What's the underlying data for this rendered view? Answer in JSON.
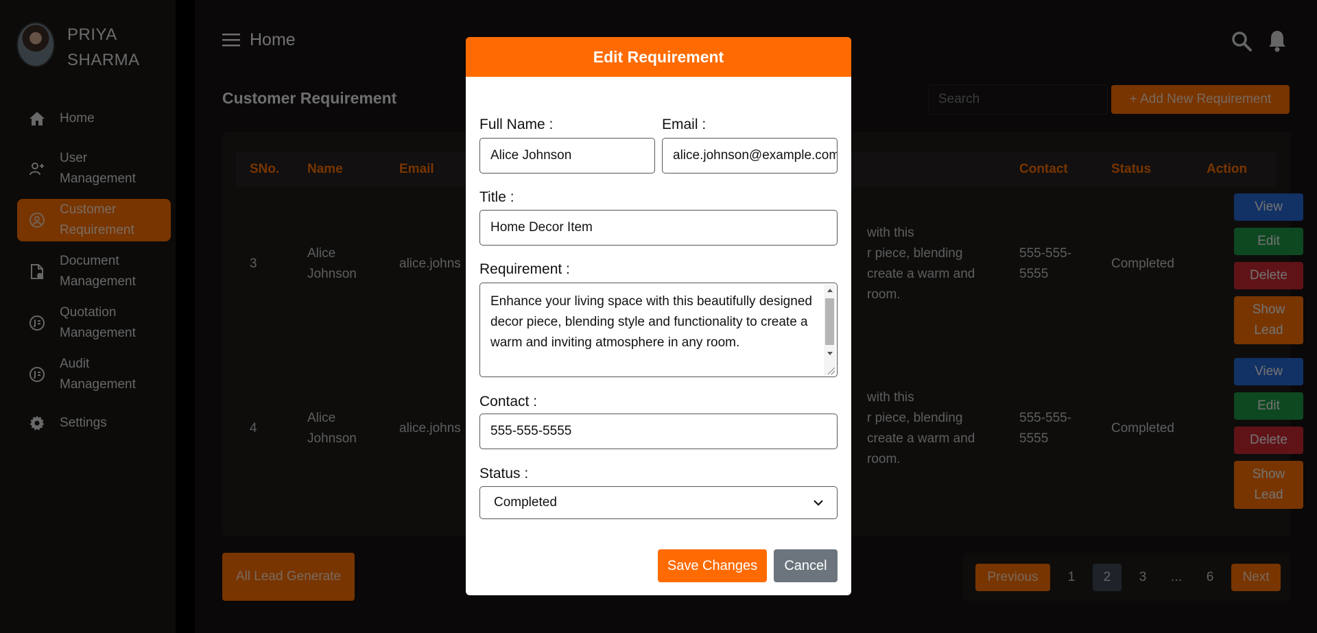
{
  "profile": {
    "name_line1": "PRIYA",
    "name_line2": "SHARMA"
  },
  "sidebar": {
    "items": [
      {
        "label": "Home",
        "icon": "home-icon"
      },
      {
        "label_line1": "User",
        "label_line2": "Management",
        "icon": "user-add-icon"
      },
      {
        "label_line1": "Customer",
        "label_line2": "Requirement",
        "icon": "customer-icon",
        "active": true
      },
      {
        "label_line1": "Document",
        "label_line2": "Management",
        "icon": "document-icon"
      },
      {
        "label_line1": "Quotation",
        "label_line2": "Management",
        "icon": "quotation-icon"
      },
      {
        "label_line1": "Audit",
        "label_line2": "Management",
        "icon": "audit-icon"
      },
      {
        "label": "Settings",
        "icon": "gear-icon"
      }
    ]
  },
  "topbar": {
    "title": "Home"
  },
  "page": {
    "heading": "Customer Requirement",
    "search_placeholder": "Search",
    "add_button": "+ Add New Requirement",
    "all_lead_button": "All Lead Generate"
  },
  "table": {
    "headers": {
      "sno": "SNo.",
      "name": "Name",
      "email": "Email",
      "contact": "Contact",
      "status": "Status",
      "action": "Action"
    },
    "rows": [
      {
        "sno": "3",
        "name_line1": "Alice",
        "name_line2": "Johnson",
        "email": "alice.johns",
        "req_line1": "with this",
        "req_line2": "r piece, blending",
        "req_line3": "create a warm and",
        "req_line4": "room.",
        "contact_line1": "555-555-",
        "contact_line2": "5555",
        "status": "Completed"
      },
      {
        "sno": "4",
        "name_line1": "Alice",
        "name_line2": "Johnson",
        "email": "alice.johns",
        "req_line1": "with this",
        "req_line2": "r piece, blending",
        "req_line3": "create a warm and",
        "req_line4": "room.",
        "contact_line1": "555-555-",
        "contact_line2": "5555",
        "status": "Completed"
      }
    ],
    "actions": {
      "view": "View",
      "edit": "Edit",
      "delete": "Delete",
      "lead_line1": "Show",
      "lead_line2": "Lead"
    }
  },
  "pagination": {
    "previous": "Previous",
    "pages": [
      "1",
      "2",
      "3",
      "...",
      "6"
    ],
    "current": "2",
    "next": "Next"
  },
  "modal": {
    "title": "Edit Requirement",
    "full_name_label": "Full Name :",
    "full_name_value": "Alice Johnson",
    "email_label": "Email :",
    "email_value": "alice.johnson@example.com",
    "title_label": "Title :",
    "title_value": "Home Decor Item",
    "requirement_label": "Requirement :",
    "requirement_value": "Enhance your living space with this beautifully designed decor piece, blending style and functionality to create a warm and inviting atmosphere in any room.",
    "contact_label": "Contact :",
    "contact_value": "555-555-5555",
    "status_label": "Status :",
    "status_value": "Completed",
    "save_button": "Save Changes",
    "cancel_button": "Cancel"
  },
  "colors": {
    "accent": "#f06a00",
    "modal_header": "#ff6b00",
    "view": "#2563c8",
    "edit": "#1c9042",
    "delete": "#c0262f",
    "cancel": "#6c757d"
  }
}
